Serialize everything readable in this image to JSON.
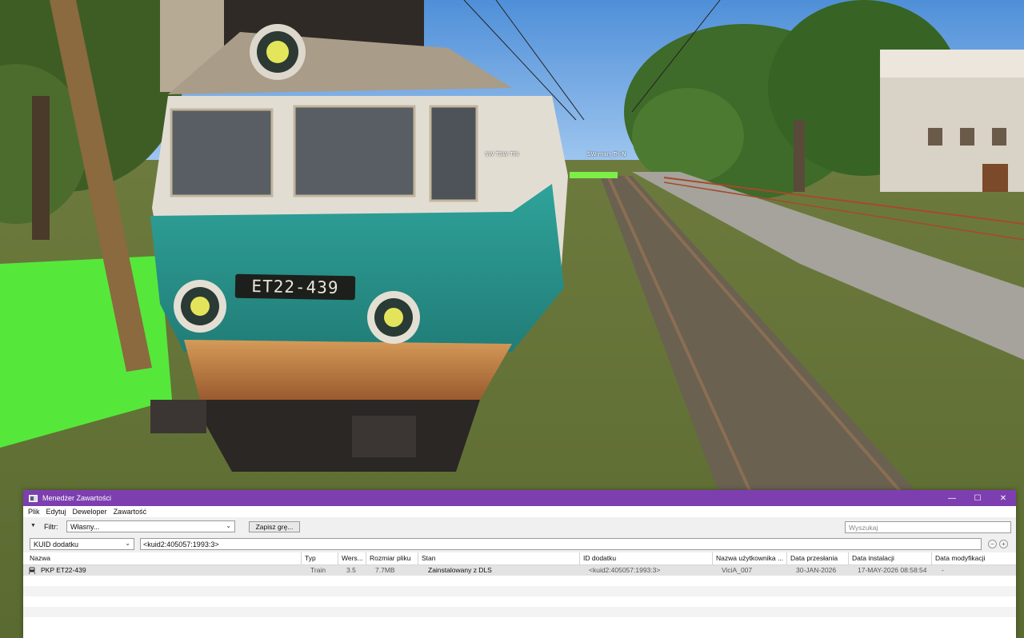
{
  "scene": {
    "locomotive_number": "ET22-439",
    "sign_labels": [
      "SW TSW TRI",
      "SW-man_Tri-N"
    ]
  },
  "window": {
    "title": "Menedżer Zawartości",
    "icons": {
      "minimize": "minimize-icon",
      "maximize": "maximize-icon",
      "close": "close-icon"
    }
  },
  "menu": [
    "Plik",
    "Edytuj",
    "Deweloper",
    "Zawartość"
  ],
  "filter": {
    "label": "Filtr:",
    "value": "Własny...",
    "save_button": "Zapisz grę...",
    "search_placeholder": "Wyszukaj"
  },
  "kuid": {
    "field": "KUID dodatku",
    "value": "<kuid2:405057:1993:3>"
  },
  "table": {
    "columns": [
      "Nazwa",
      "Typ",
      "Wers...",
      "Rozmiar pliku",
      "Stan",
      "ID dodatku",
      "Nazwa użytkownika ...",
      "Data przesłania",
      "Data instalacji",
      "Data modyfikacji"
    ],
    "rows": [
      {
        "name": "PKP ET22-439",
        "type": "Train",
        "version": "3.5",
        "size": "7.7MB",
        "status": "Zainstalowany z DLS",
        "kuid": "<kuid2:405057:1993:3>",
        "user": "ViciA_007",
        "uploaded": "30-JAN-2026",
        "installed": "17-MAY-2026 08:58:54",
        "modified": "-"
      }
    ]
  }
}
